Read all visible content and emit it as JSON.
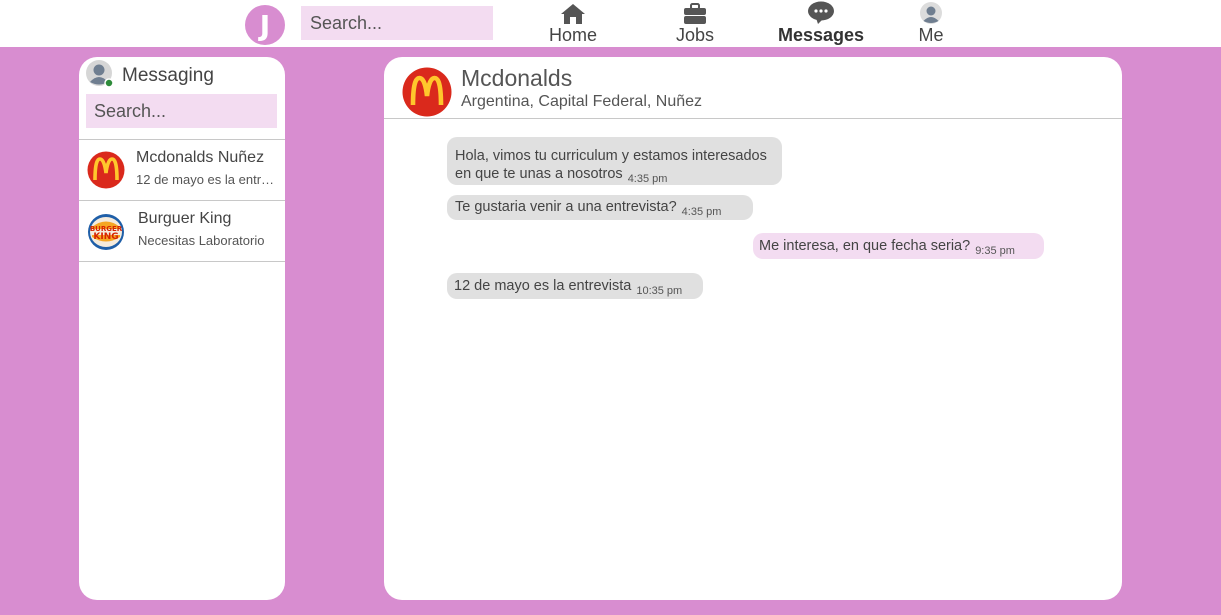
{
  "app": {
    "logo_letter": "J",
    "search_placeholder": "Search..."
  },
  "nav": {
    "home": {
      "label": "Home",
      "icon": "home-icon"
    },
    "jobs": {
      "label": "Jobs",
      "icon": "briefcase-icon"
    },
    "messages": {
      "label": "Messages",
      "icon": "chat-bubble-icon",
      "active": true
    },
    "me": {
      "label": "Me",
      "icon": "user-avatar-icon"
    }
  },
  "sidebar": {
    "title": "Messaging",
    "search_placeholder": "Search...",
    "conversations": [
      {
        "name": "Mcdonalds Nuñez",
        "preview": "12 de mayo es la entrevista",
        "logo": "mcdonalds-logo"
      },
      {
        "name": "Burguer King",
        "preview": "Necesitas Laboratorio",
        "logo": "burger-king-logo"
      }
    ]
  },
  "chat": {
    "contact_name": "Mcdonalds",
    "contact_location": "Argentina, Capital Federal, Nuñez",
    "messages": [
      {
        "direction": "in",
        "text": "Hola, vimos tu curriculum y estamos interesados en que te unas a nosotros",
        "time": "4:35 pm"
      },
      {
        "direction": "in",
        "text": "Te gustaria venir a una entrevista?",
        "time": "4:35 pm"
      },
      {
        "direction": "out",
        "text": "Me interesa, en que fecha seria?",
        "time": "9:35 pm"
      },
      {
        "direction": "in",
        "text": "12 de mayo es la entrevista",
        "time": "10:35 pm"
      }
    ]
  },
  "colors": {
    "accent": "#d88dd0",
    "search_bg": "#f3dcf1",
    "incoming_bubble": "#e0e0e0",
    "outgoing_bubble": "#f3dcf1",
    "mcdonalds_red": "#da291c",
    "mcdonalds_yellow": "#ffc72c"
  }
}
